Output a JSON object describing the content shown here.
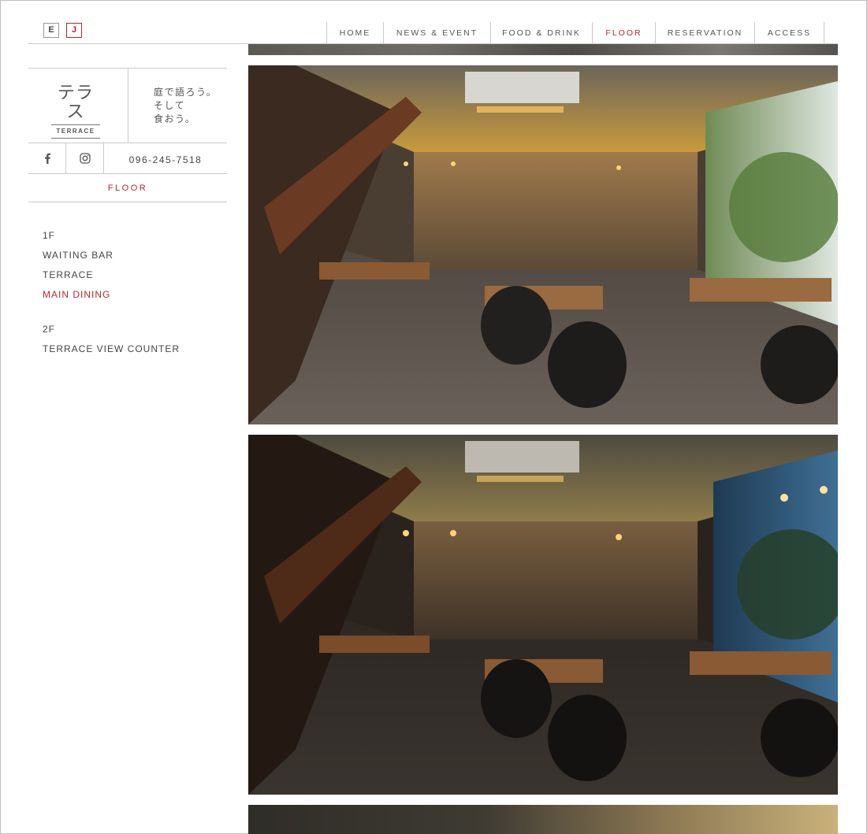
{
  "lang": {
    "en": "E",
    "ja": "J"
  },
  "nav": {
    "items": [
      {
        "label": "HOME"
      },
      {
        "label": "NEWS & EVENT"
      },
      {
        "label": "FOOD & DRINK"
      },
      {
        "label": "FLOOR"
      },
      {
        "label": "RESERVATION"
      },
      {
        "label": "ACCESS"
      }
    ],
    "active": "FLOOR"
  },
  "brand": {
    "logo_jp": "テラス",
    "logo_en": "TERRACE",
    "tagline": [
      "庭で語ろう。",
      "そして",
      "食おう。"
    ]
  },
  "social": {
    "icons": [
      "facebook-icon",
      "instagram-icon"
    ],
    "phone": "096-245-7518"
  },
  "section_title": "FLOOR",
  "floors": {
    "floor1": {
      "label": "1F",
      "items": [
        "WAITING BAR",
        "TERRACE",
        "MAIN DINING"
      ]
    },
    "floor2": {
      "label": "2F",
      "items": [
        "TERRACE VIEW COUNTER"
      ]
    },
    "active_item": "MAIN DINING"
  },
  "colors": {
    "accent": "#b5272d",
    "text": "#444444",
    "rule": "#c9c9c9"
  }
}
